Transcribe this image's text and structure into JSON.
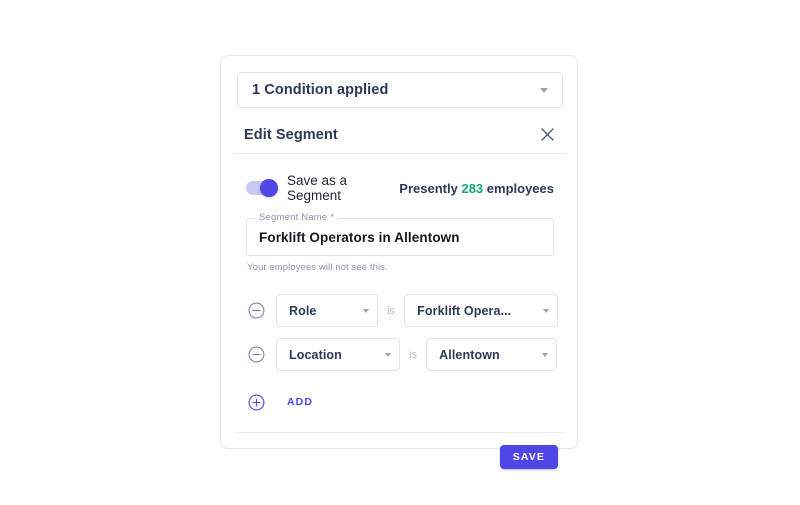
{
  "condition_summary": {
    "label": "1 Condition applied",
    "caret_icon": "chevron-down-icon"
  },
  "dialog": {
    "title": "Edit Segment",
    "close_icon": "close-icon"
  },
  "save_segment": {
    "toggle_label": "Save as a Segment",
    "toggle_on": true,
    "employee_count": {
      "prefix": "Presently",
      "number": "283",
      "suffix": "employees"
    }
  },
  "segment_name_field": {
    "legend": "Segment Name *",
    "value": "Forklift Operators in Allentown",
    "placeholder": "Segment Name",
    "helper_text": "Your employees will not see this."
  },
  "conditions": [
    {
      "remove_icon": "minus-circle-icon",
      "attribute": "Role",
      "operator": "is",
      "value": "Forklift Opera..."
    },
    {
      "remove_icon": "minus-circle-icon",
      "attribute": "Location",
      "operator": "is",
      "value": "Allentown"
    }
  ],
  "add_condition": {
    "icon": "plus-circle-icon",
    "label": "ADD"
  },
  "footer": {
    "save_label": "SAVE"
  },
  "colors": {
    "accent": "#4f46e5",
    "count_green": "#18a47c",
    "text_navy": "#2b3a59",
    "muted": "#8b93a7",
    "border": "#dfe3ea"
  }
}
